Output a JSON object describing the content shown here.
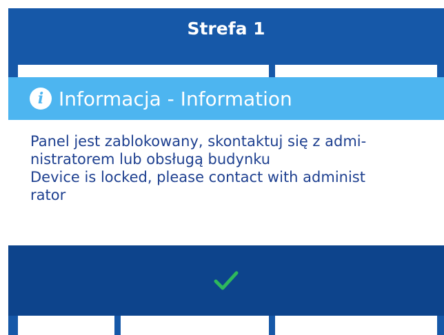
{
  "zone": {
    "title": "Strefa 1"
  },
  "dialog": {
    "title": "Informacja - Information",
    "icon": "info-icon",
    "message_lines": [
      "Panel jest zablokowany, skontaktuj się z admi-",
      "nistratorem lub obsługą budynku",
      "Device is locked, please contact with administ",
      "rator"
    ],
    "confirm_icon": "checkmark-icon"
  },
  "colors": {
    "background": "#1658a8",
    "header": "#4db5f0",
    "footer": "#0d448c",
    "text": "#1d3f8f",
    "check": "#2eb85c"
  }
}
